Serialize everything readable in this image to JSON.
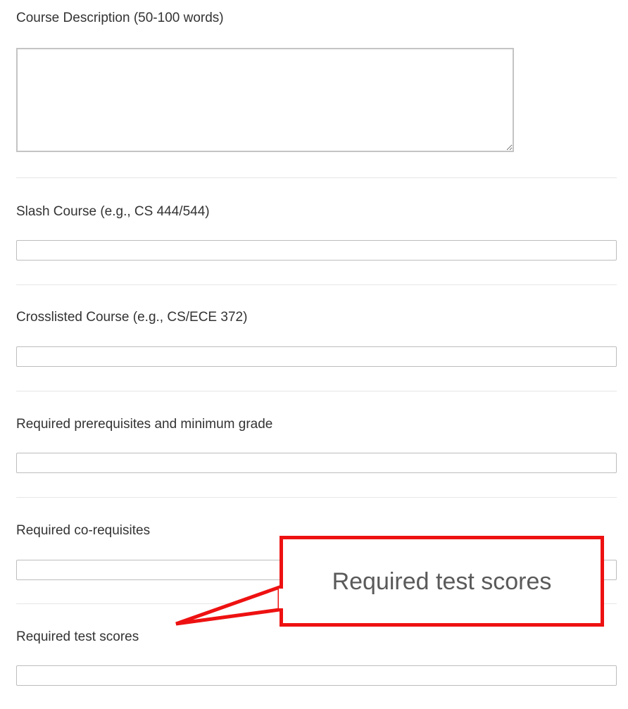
{
  "form": {
    "course_description": {
      "label": "Course Description (50-100 words)",
      "value": "",
      "placeholder": ""
    },
    "slash_course": {
      "label": "Slash Course (e.g., CS 444/544)",
      "value": "",
      "placeholder": ""
    },
    "crosslisted_course": {
      "label": "Crosslisted Course (e.g., CS/ECE 372)",
      "value": "",
      "placeholder": ""
    },
    "prerequisites": {
      "label": "Required prerequisites and minimum grade",
      "value": "",
      "placeholder": ""
    },
    "corequisites": {
      "label": "Required co-requisites",
      "value": "",
      "placeholder": ""
    },
    "test_scores": {
      "label": "Required test scores",
      "value": "",
      "placeholder": ""
    }
  },
  "callout": {
    "text": "Required test scores",
    "border_color": "#ee1111"
  }
}
